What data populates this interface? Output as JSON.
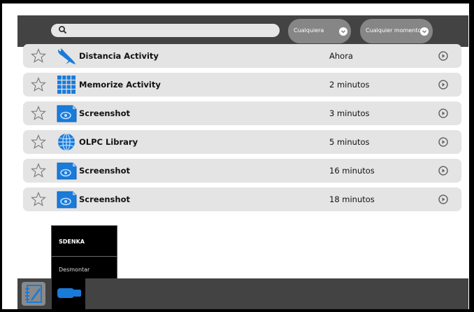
{
  "toolbar": {
    "search_placeholder": "",
    "filter_type": "Cualquiera",
    "filter_time": "Cualquier momento"
  },
  "entries": [
    {
      "title": "Distancia Activity",
      "time": "Ahora",
      "icon": "distance-activity-icon",
      "starred": false
    },
    {
      "title": "Memorize Activity",
      "time": "2 minutos",
      "icon": "memorize-activity-icon",
      "starred": false
    },
    {
      "title": "Screenshot",
      "time": "3 minutos",
      "icon": "image-file-icon",
      "starred": false
    },
    {
      "title": "OLPC Library",
      "time": "5 minutos",
      "icon": "globe-icon",
      "starred": false
    },
    {
      "title": "Screenshot",
      "time": "16 minutos",
      "icon": "image-file-icon",
      "starred": false
    },
    {
      "title": "Screenshot",
      "time": "18 minutos",
      "icon": "image-file-icon",
      "starred": false
    }
  ],
  "popup": {
    "title": "SDENKA",
    "item": "Desmontar"
  },
  "colors": {
    "toolbar": "#434343",
    "row": "#e4e4e4",
    "accent_blue": "#1a7bd9"
  }
}
